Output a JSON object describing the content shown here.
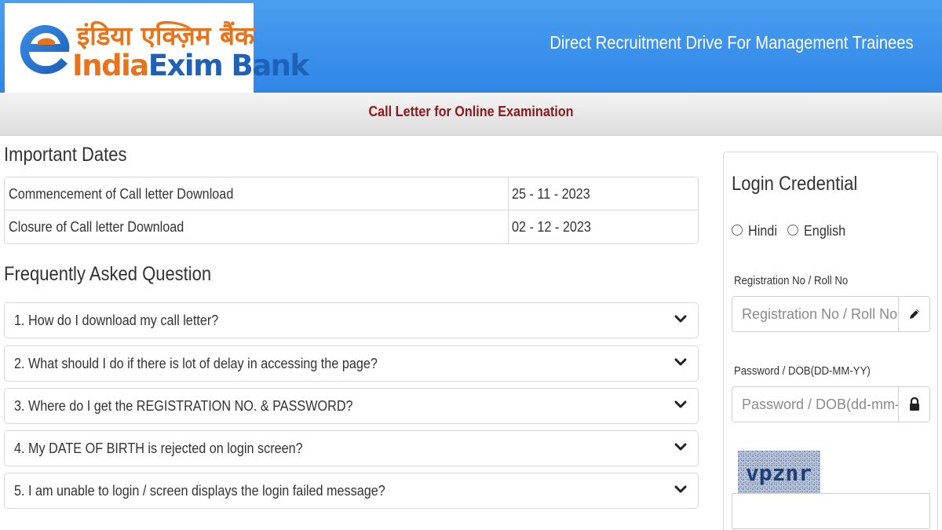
{
  "header": {
    "logo_hindi": "इंडिया एक्ज़िम बैंक",
    "logo_english_1": "India",
    "logo_english_2": "Exim Bank",
    "title": "Direct Recruitment Drive For Management Trainees",
    "colors": {
      "header_blue": "#3a8fe9",
      "logo_orange": "#e8731a",
      "logo_blue": "#1d62b8"
    }
  },
  "subbar": {
    "title": "Call Letter for Online Examination",
    "title_color": "#8b1a1a"
  },
  "important_dates": {
    "title": "Important Dates",
    "rows": [
      {
        "label": "Commencement of Call letter Download",
        "value": "25 - 11 - 2023"
      },
      {
        "label": "Closure of Call letter Download",
        "value": "02 - 12 - 2023"
      }
    ]
  },
  "faq": {
    "title": "Frequently Asked Question",
    "items": [
      {
        "question": "1. How do I download my call letter?"
      },
      {
        "question": "2. What should I do if there is lot of delay in accessing the page?"
      },
      {
        "question": "3. Where do I get the REGISTRATION NO. & PASSWORD?"
      },
      {
        "question": "4. My DATE OF BIRTH is rejected on login screen?"
      },
      {
        "question": "5. I am unable to login / screen displays the login failed message?"
      }
    ],
    "icon": "chevron-down-icon"
  },
  "login": {
    "title": "Login Credential",
    "languages": [
      "Hindi",
      "English"
    ],
    "registration": {
      "label": "Registration No / Roll No",
      "placeholder": "Registration No / Roll No",
      "value": "",
      "icon": "pencil-icon"
    },
    "password": {
      "label": "Password / DOB(DD-MM-YY)",
      "placeholder": "Password / DOB(dd-mm-yy)",
      "value": "",
      "icon": "lock-icon"
    },
    "captcha": {
      "text": "vpznr",
      "value": ""
    }
  }
}
